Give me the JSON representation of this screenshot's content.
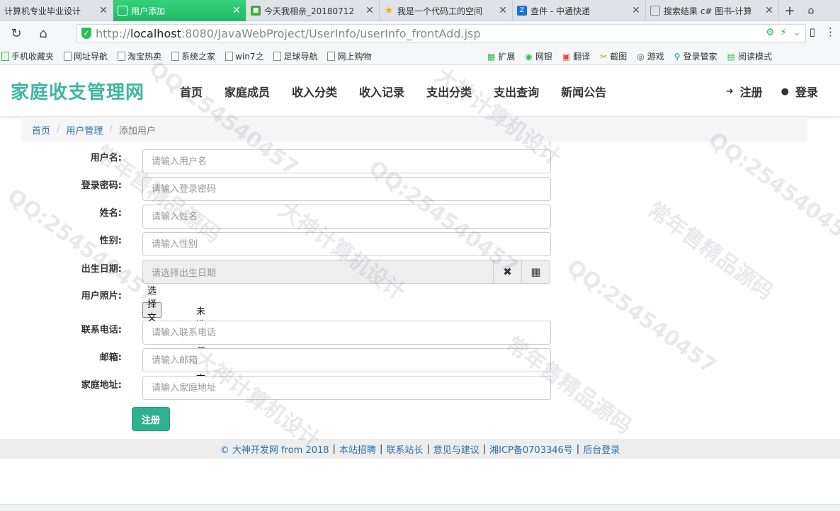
{
  "browser": {
    "tabs": [
      {
        "title": "计算机专业毕业设计",
        "active": false
      },
      {
        "title": "用户添加",
        "active": true
      },
      {
        "title": "今天我相亲_20180712",
        "active": false
      },
      {
        "title": "我是一个代码工的空间",
        "active": false
      },
      {
        "title": "查件 - 中通快递",
        "active": false
      },
      {
        "title": "搜索结果 c# 图书-计算",
        "active": false
      }
    ],
    "url_scheme": "http://",
    "url_host": "localhost",
    "url_path": ":8080/JavaWebProject/UserInfo/userInfo_frontAdd.jsp",
    "bookmarks_left": [
      "手机收藏夹",
      "网址导航",
      "淘宝热卖",
      "系统之家",
      "win7之",
      "足球导航",
      "网上购物"
    ],
    "bookmarks_right": [
      "扩展",
      "网银",
      "翻译",
      "截图",
      "游戏",
      "登录管家",
      "阅读模式"
    ]
  },
  "site": {
    "brand": "家庭收支管理网",
    "menu": [
      "首页",
      "家庭成员",
      "收入分类",
      "收入记录",
      "支出分类",
      "支出查询",
      "新闻公告"
    ],
    "register_label": "注册",
    "login_label": "登录"
  },
  "breadcrumb": {
    "home": "首页",
    "section": "用户管理",
    "current": "添加用户"
  },
  "form": {
    "username": {
      "label": "用户名:",
      "placeholder": "请输入用户名"
    },
    "password": {
      "label": "登录密码:",
      "placeholder": "请输入登录密码"
    },
    "name": {
      "label": "姓名:",
      "placeholder": "请输入姓名"
    },
    "gender": {
      "label": "性别:",
      "placeholder": "请输入性别"
    },
    "birthday": {
      "label": "出生日期:",
      "placeholder": "请选择出生日期"
    },
    "photo": {
      "label": "用户照片:",
      "button": "选择文件",
      "status": "未选择任何文件"
    },
    "phone": {
      "label": "联系电话:",
      "placeholder": "请输入联系电话"
    },
    "email": {
      "label": "邮箱:",
      "placeholder": "请输入邮箱"
    },
    "address": {
      "label": "家庭地址:",
      "placeholder": "请输入家庭地址"
    },
    "submit_label": "注册"
  },
  "footer": {
    "copyright": "© 大神开发网 from 2018",
    "links": [
      "本站招聘",
      "联系站长",
      "意见与建议",
      "湘ICP备0703346号",
      "后台登录"
    ]
  },
  "watermarks": [
    "QQ:254540457",
    "大神计算机设计",
    "常年售精品源码"
  ]
}
